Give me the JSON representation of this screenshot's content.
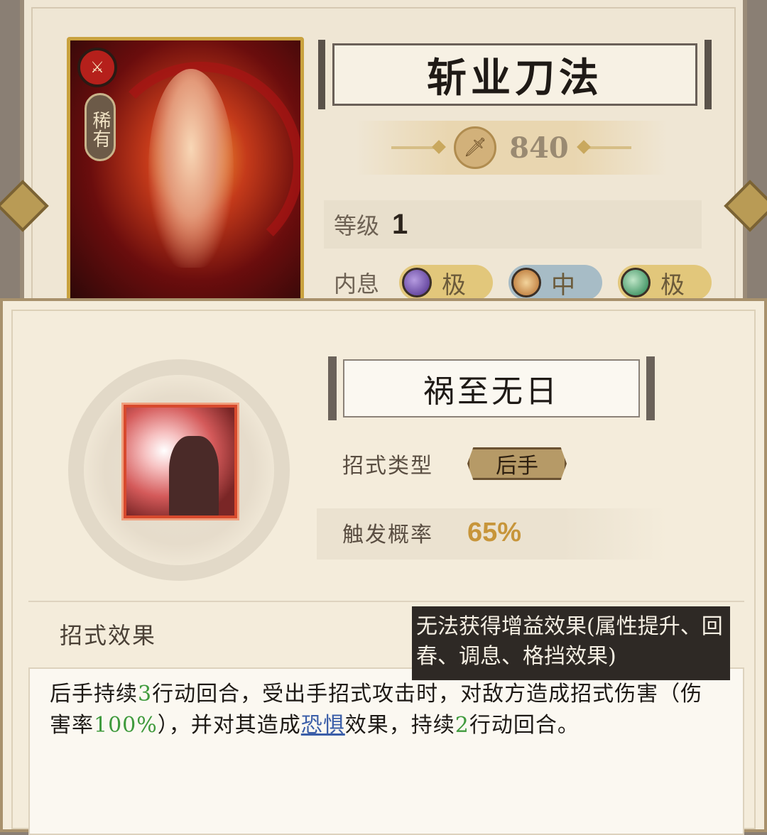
{
  "background": {
    "title": "斩业刀法",
    "power": "840",
    "level_label": "等级",
    "level_value": "1",
    "breath_label": "内息",
    "breath_slots": [
      {
        "grade": "极",
        "color": "purple"
      },
      {
        "grade": "中",
        "color": "orange"
      },
      {
        "grade": "极",
        "color": "green"
      }
    ],
    "card": {
      "rarity": "稀有"
    }
  },
  "popup": {
    "move_name": "祸至无日",
    "type_label": "招式类型",
    "type_value": "后手",
    "rate_label": "触发概率",
    "rate_value": "65%",
    "effect_label": "招式效果",
    "description": {
      "p1": "后手持续",
      "n1": "3",
      "p2": "行动回合，受出手招式攻击时，对敌方造成招式伤害（伤害率",
      "n2": "100%",
      "p3": "），并对其造成",
      "link": "恐惧",
      "p4": "效果，持续",
      "n3": "2",
      "p5": "行动回合。"
    },
    "tooltip": "无法获得增益效果(属性提升、回春、调息、格挡效果)"
  },
  "colors": {
    "accent_gold": "#c9a23f",
    "number_green": "#3f9a3c",
    "link_blue": "#3b5ea8",
    "rate_gold": "#c7953a"
  }
}
